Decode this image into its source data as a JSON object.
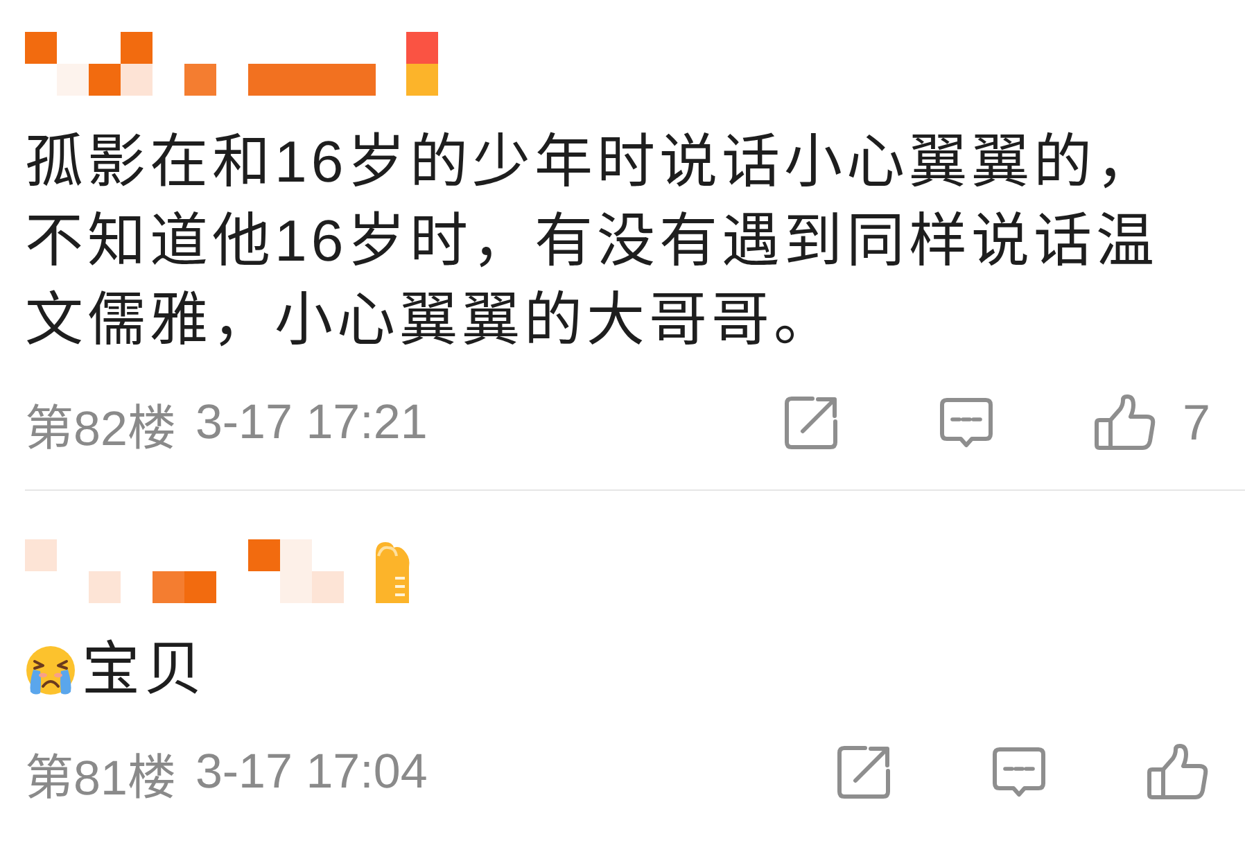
{
  "comments": [
    {
      "author": {
        "pixelated": true
      },
      "content": [
        {
          "kind": "text",
          "text": "孤影在和16岁的少年时说话小心翼翼的，不知道他16岁时，有没有遇到同样说话温文儒雅，小心翼翼的大哥哥。"
        }
      ],
      "floor": "第82楼",
      "time": "3-17 17:21",
      "actions": [
        {
          "kind": "share"
        },
        {
          "kind": "reply"
        },
        {
          "kind": "like",
          "count": "7"
        }
      ]
    },
    {
      "author": {
        "pixelated": true
      },
      "content": [
        {
          "kind": "emoji"
        },
        {
          "kind": "text",
          "text": "宝贝"
        }
      ],
      "floor": "第81楼",
      "time": "3-17 17:04",
      "actions": [
        {
          "kind": "share"
        },
        {
          "kind": "reply"
        },
        {
          "kind": "like"
        }
      ]
    }
  ]
}
